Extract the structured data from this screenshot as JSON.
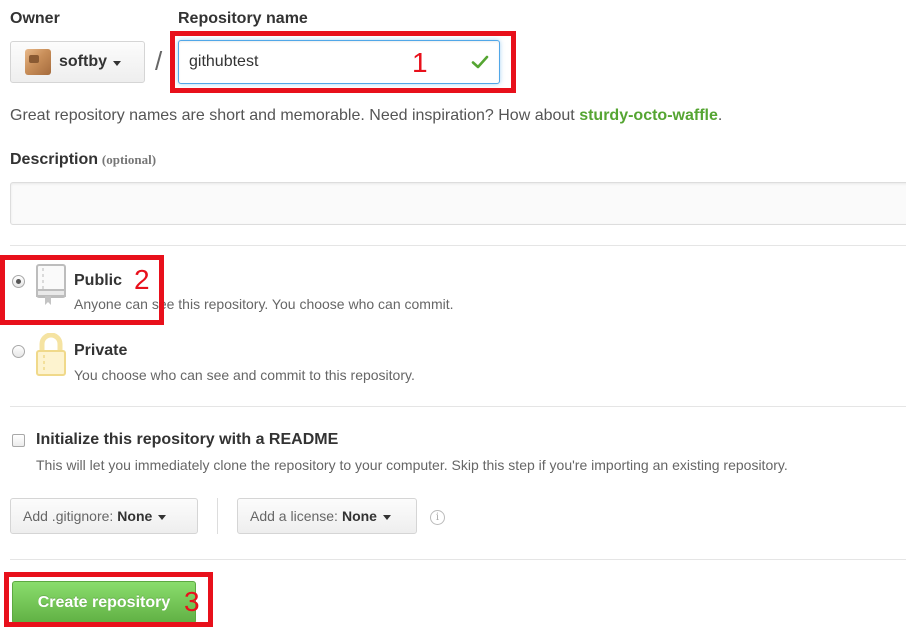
{
  "owner": {
    "label": "Owner",
    "name": "softby"
  },
  "separator": "/",
  "repo_name": {
    "label": "Repository name",
    "value": "githubtest"
  },
  "hint": {
    "text": "Great repository names are short and memorable. Need inspiration? How about ",
    "suggestion": "sturdy-octo-waffle",
    "end": "."
  },
  "description": {
    "label": "Description",
    "optional": "(optional)",
    "value": ""
  },
  "visibility": {
    "public": {
      "title": "Public",
      "desc": "Anyone can see this repository. You choose who can commit.",
      "selected": true
    },
    "private": {
      "title": "Private",
      "desc": "You choose who can see and commit to this repository.",
      "selected": false
    }
  },
  "readme": {
    "label": "Initialize this repository with a README",
    "desc": "This will let you immediately clone the repository to your computer. Skip this step if you're importing an existing repository.",
    "checked": false
  },
  "gitignore": {
    "prefix": "Add .gitignore:",
    "value": "None"
  },
  "license": {
    "prefix": "Add a license:",
    "value": "None"
  },
  "create_button": "Create repository",
  "annotations": {
    "one": "1",
    "two": "2",
    "three": "3"
  },
  "colors": {
    "accent_green": "#55a532",
    "button_green": "#6cc644",
    "annotation_red": "#e8101b",
    "focus_blue": "#51a7e8"
  },
  "icons": [
    "caret-down-icon",
    "check-icon",
    "repo-book-icon",
    "lock-icon",
    "info-icon"
  ]
}
